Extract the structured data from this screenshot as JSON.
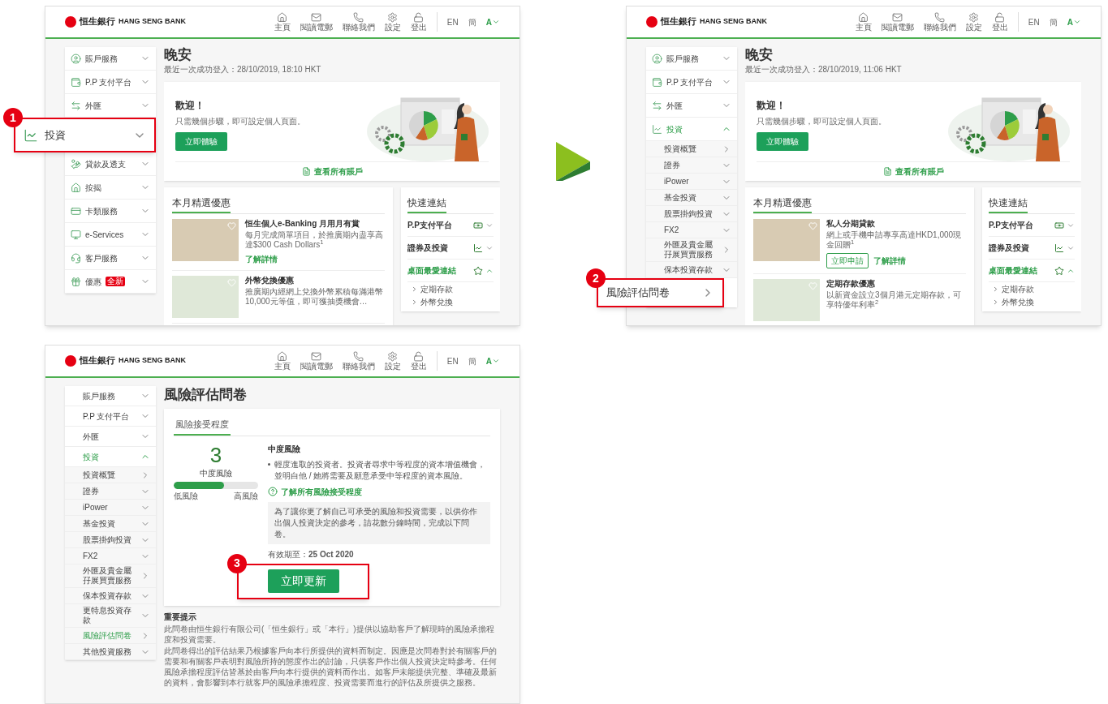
{
  "screens": [
    {
      "kind": "home",
      "header": {
        "logo": "恒生銀行",
        "brand": "HANG SENG BANK",
        "nav": [
          "主頁",
          "閱讀電郵",
          "聯絡我們",
          "設定",
          "登出"
        ],
        "languages": [
          "EN",
          "簡"
        ],
        "font_size": "A"
      },
      "sidebar": [
        {
          "label": "賬戶服務",
          "kind": "menu",
          "expanded": false
        },
        {
          "label": "P.P 支付平台",
          "kind": "menu",
          "expanded": false
        },
        {
          "label": "外匯",
          "kind": "menu",
          "expanded": false
        },
        {
          "label": "投資",
          "kind": "menu",
          "expanded": false,
          "callout": "1"
        },
        {
          "label": "貸款及透支",
          "kind": "menu",
          "expanded": false
        },
        {
          "label": "按揭",
          "kind": "menu",
          "expanded": false
        },
        {
          "label": "卡類服務",
          "kind": "menu",
          "expanded": false
        },
        {
          "label": "e-Services",
          "kind": "menu",
          "expanded": false
        },
        {
          "label": "客戶服務",
          "kind": "menu",
          "expanded": false
        },
        {
          "label": "優惠",
          "kind": "menu",
          "expanded": false,
          "badge": "全新"
        }
      ],
      "greeting": "晚安",
      "last_login": "最近一次成功登入：28/10/2019, 18:10 HKT",
      "welcome": {
        "title": "歡迎！",
        "text": "只需幾個步驟，即可設定個人頁面。",
        "button": "立即體驗",
        "link": "查看所有賬戶"
      },
      "offers": {
        "title": "本月精選優惠",
        "items": [
          {
            "title": "恒生個人e-Banking 月用月有賞",
            "text": "每月完成簡單項目，於推廣期內盡享高達$300 Cash Dollars$^{1}$",
            "links": [
              {
                "label": "了解詳情",
                "kind": "text"
              }
            ]
          },
          {
            "title": "外幣兌換優惠",
            "text": "推廣期內經網上兌換外幣累積每滿港幣10,000元等值，即可獲抽獎機會…"
          }
        ]
      },
      "quick_links": {
        "title": "快速連結",
        "items": [
          {
            "label": "P.P支付平台",
            "expanded": false
          },
          {
            "label": "證券及投資",
            "expanded": false
          },
          {
            "label": "桌面最愛連結",
            "expanded": true,
            "children": [
              "定期存款",
              "外幣兌換"
            ]
          }
        ]
      }
    },
    {
      "kind": "home",
      "header": {
        "logo": "恒生銀行",
        "brand": "HANG SENG BANK",
        "nav": [
          "主頁",
          "閱讀電郵",
          "聯絡我們",
          "設定",
          "登出"
        ],
        "languages": [
          "EN",
          "簡"
        ],
        "font_size": "A"
      },
      "sidebar": [
        {
          "label": "賬戶服務",
          "kind": "menu",
          "expanded": false
        },
        {
          "label": "P.P 支付平台",
          "kind": "menu",
          "expanded": false
        },
        {
          "label": "外匯",
          "kind": "menu",
          "expanded": false
        },
        {
          "label": "投資",
          "kind": "menu",
          "expanded": true,
          "children": [
            {
              "label": "投資概覽",
              "kind": "link"
            },
            {
              "label": "證券",
              "kind": "menu",
              "expanded": false
            },
            {
              "label": "iPower",
              "kind": "menu",
              "expanded": false
            },
            {
              "label": "基金投資",
              "kind": "menu",
              "expanded": false
            },
            {
              "label": "股票掛鉤投資",
              "kind": "menu",
              "expanded": false
            },
            {
              "label": "FX2",
              "kind": "menu",
              "expanded": false
            },
            {
              "label": "外匯及貴金屬孖展買賣服務",
              "kind": "link"
            },
            {
              "label": "保本投資存款",
              "kind": "menu",
              "expanded": false
            },
            {
              "label": "風險評估問卷",
              "kind": "link",
              "callout": "2"
            }
          ]
        }
      ],
      "greeting": "晚安",
      "last_login": "最近一次成功登入：28/10/2019, 11:06 HKT",
      "welcome": {
        "title": "歡迎！",
        "text": "只需幾個步驟，即可設定個人頁面。",
        "button": "立即體驗",
        "link": "查看所有賬戶"
      },
      "offers": {
        "title": "本月精選優惠",
        "items": [
          {
            "title": "私人分期貸款",
            "text": "網上或手機申請專享高達HKD1,000現金回贈$^{1}$",
            "links": [
              {
                "label": "立即申請",
                "kind": "outline"
              },
              {
                "label": "了解詳情",
                "kind": "text"
              }
            ]
          },
          {
            "title": "定期存款優惠",
            "text": "以新資金設立3個月港元定期存款，可享特優年利率$^{2}$"
          }
        ]
      },
      "quick_links": {
        "title": "快速連結",
        "items": [
          {
            "label": "P.P支付平台",
            "expanded": false
          },
          {
            "label": "證券及投資",
            "expanded": false
          },
          {
            "label": "桌面最愛連結",
            "expanded": true,
            "children": [
              "定期存款",
              "外幣兌換"
            ]
          }
        ]
      }
    },
    {
      "kind": "risk",
      "header": {
        "logo": "恒生銀行",
        "brand": "HANG SENG BANK",
        "nav": [
          "主頁",
          "閱讀電郵",
          "聯絡我們",
          "設定",
          "登出"
        ],
        "languages": [
          "EN",
          "簡"
        ],
        "font_size": "A"
      },
      "sidebar": [
        {
          "label": "賬戶服務",
          "kind": "menu",
          "expanded": false,
          "selected": false
        },
        {
          "label": "P.P 支付平台",
          "kind": "menu",
          "expanded": false,
          "selected": false
        },
        {
          "label": "外匯",
          "kind": "menu",
          "expanded": false,
          "selected": false
        },
        {
          "label": "投資",
          "kind": "menu",
          "expanded": true,
          "selected": true,
          "children": [
            {
              "label": "投資概覽",
              "kind": "link",
              "selected": false
            },
            {
              "label": "證券",
              "kind": "menu",
              "expanded": false,
              "selected": false
            },
            {
              "label": "iPower",
              "kind": "menu",
              "expanded": false,
              "selected": false
            },
            {
              "label": "基金投資",
              "kind": "menu",
              "expanded": false,
              "selected": false
            },
            {
              "label": "股票掛鉤投資",
              "kind": "menu",
              "expanded": false,
              "selected": false
            },
            {
              "label": "FX2",
              "kind": "menu",
              "expanded": false,
              "selected": false
            },
            {
              "label": "外匯及貴金屬孖展買賣服務",
              "kind": "link",
              "selected": false
            },
            {
              "label": "保本投資存款",
              "kind": "menu",
              "expanded": false,
              "selected": false
            },
            {
              "label": "更特息投資存款",
              "kind": "menu",
              "expanded": false,
              "selected": false
            },
            {
              "label": "風險評估問卷",
              "kind": "link",
              "selected": true
            },
            {
              "label": "其他投資服務",
              "kind": "menu",
              "expanded": false,
              "selected": false
            }
          ]
        }
      ],
      "title": "風險評估問卷",
      "tab": {
        "label": "風險接受程度",
        "selected": true
      },
      "score": "3",
      "score_label": "中度風險",
      "level": 0.6,
      "scale_min": "低風險",
      "scale_max": "高風險",
      "risk_title": "中度風險",
      "bullets": [
        "輕度進取的投資者。投資者尋求中等程度的資本增值機會，並明白他 / 她將需要及願意承受中等程度的資本風險。"
      ],
      "help_link": "了解所有風險接受程度",
      "note": "為了讓你更了解自己可承受的風險和投資需要，以供你作出個人投資決定的參考，請花數分鐘時間，完成以下問卷。",
      "valid": "有效期至：**25 Oct 2020**",
      "button": {
        "label": "立即更新",
        "callout": "3"
      },
      "notice": {
        "title": "重要提示",
        "paragraphs": [
          "此問卷由恒生銀行有限公司(「恒生銀行」或「本行」)提供以協助客戶了解現時的風險承擔程度和投資需要。",
          "此問卷得出的評估結果乃根據客戶向本行所提供的資料而制定。因應是次問卷對於有關客戶的需要和有關客戶表明對風險所持的態度作出的討論，只供客戶作出個人投資決定時參考。任何風險承擔程度評估皆基於由客戶向本行提供的資料而作出。如客戶未能提供完整、準確及最新的資料，會影響到本行就客戶的風險承擔程度、投資需要而進行的評估及所提供之服務。"
        ]
      }
    }
  ]
}
